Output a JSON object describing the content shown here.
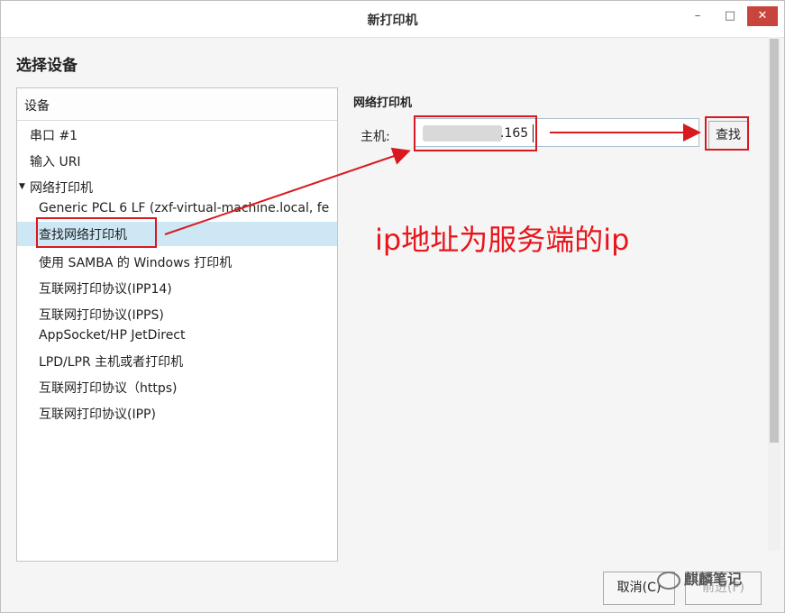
{
  "window": {
    "title": "新打印机",
    "minimize_glyph": "–",
    "maximize_glyph": "□",
    "close_glyph": "✕"
  },
  "page": {
    "heading": "选择设备"
  },
  "device_list": {
    "header": "设备",
    "items": [
      {
        "label": "串口 #1",
        "level": "top"
      },
      {
        "label": "输入 URI",
        "level": "top"
      },
      {
        "label": "网络打印机",
        "level": "top",
        "expanded": true
      },
      {
        "label": "Generic PCL 6 LF (zxf-virtual-machine.local, fe",
        "level": "sub"
      },
      {
        "label": "查找网络打印机",
        "level": "sub",
        "selected": true
      },
      {
        "label": "使用 SAMBA 的 Windows 打印机",
        "level": "sub"
      },
      {
        "label": "互联网打印协议(IPP14)",
        "level": "sub"
      },
      {
        "label": "互联网打印协议(IPPS)",
        "level": "sub"
      },
      {
        "label": "AppSocket/HP JetDirect",
        "level": "sub"
      },
      {
        "label": "LPD/LPR 主机或者打印机",
        "level": "sub"
      },
      {
        "label": "互联网打印协议（https)",
        "level": "sub"
      },
      {
        "label": "互联网打印协议(IPP)",
        "level": "sub"
      }
    ]
  },
  "network_printer": {
    "title": "网络打印机",
    "host_label": "主机:",
    "host_value_visible": ".165",
    "find_button": "查找"
  },
  "annotation": {
    "text": "ip地址为服务端的ip",
    "color": "#e8151b"
  },
  "buttons": {
    "cancel": "取消(C)",
    "forward": "前进(F)"
  },
  "watermark": {
    "text": "麒麟笔记"
  },
  "colors": {
    "selection": "#cde7f5",
    "highlight": "#d8191f",
    "close_button": "#c7453c"
  }
}
